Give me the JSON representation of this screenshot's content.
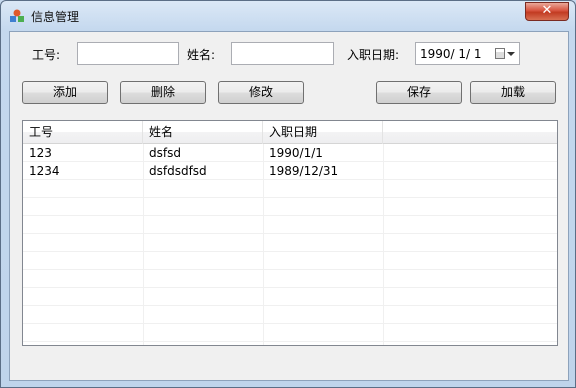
{
  "window": {
    "title": "信息管理",
    "close_label": "✕"
  },
  "form": {
    "id_label": "工号:",
    "id_value": "",
    "name_label": "姓名:",
    "name_value": "",
    "date_label": "入职日期:",
    "date_value": "1990/  1/  1"
  },
  "toolbar": {
    "add_label": "添加",
    "delete_label": "删除",
    "edit_label": "修改",
    "save_label": "保存",
    "load_label": "加载"
  },
  "table": {
    "columns": [
      "工号",
      "姓名",
      "入职日期",
      ""
    ],
    "rows": [
      [
        "123",
        "dsfsd",
        "1990/1/1"
      ],
      [
        "1234",
        "dsfdsdfsd",
        "1989/12/31"
      ]
    ]
  }
}
